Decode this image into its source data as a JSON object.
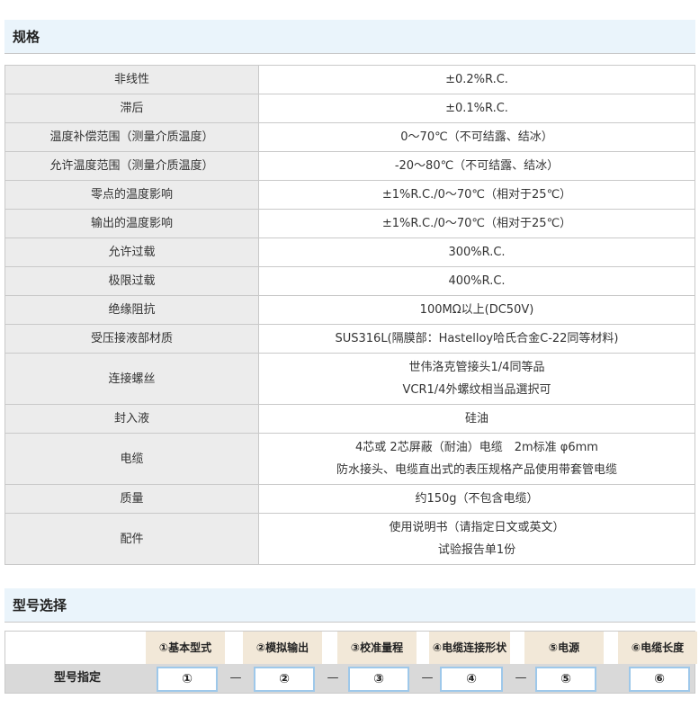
{
  "spec_section": {
    "title": "规格",
    "rows": [
      {
        "label": "非线性",
        "lines": [
          "±0.2%R.C."
        ]
      },
      {
        "label": "滞后",
        "lines": [
          "±0.1%R.C."
        ]
      },
      {
        "label": "温度补偿范围（测量介质温度）",
        "lines": [
          "0～70℃（不可结露、结冰）"
        ]
      },
      {
        "label": "允许温度范围（测量介质温度）",
        "lines": [
          "-20～80℃（不可结露、结冰）"
        ]
      },
      {
        "label": "零点的温度影响",
        "lines": [
          "±1%R.C./0～70℃（相对于25℃）"
        ]
      },
      {
        "label": "输出的温度影响",
        "lines": [
          "±1%R.C./0～70℃（相对于25℃）"
        ]
      },
      {
        "label": "允许过载",
        "lines": [
          "300%R.C."
        ]
      },
      {
        "label": "极限过载",
        "lines": [
          "400%R.C."
        ]
      },
      {
        "label": "绝缘阻抗",
        "lines": [
          "100MΩ以上(DC50V)"
        ]
      },
      {
        "label": "受压接液部材质",
        "lines": [
          "SUS316L(隔膜部：Hastelloy哈氏合金C-22同等材料)"
        ]
      },
      {
        "label": "连接螺丝",
        "lines": [
          "世伟洛克管接头1/4同等品",
          "VCR1/4外螺纹相当品選択可"
        ]
      },
      {
        "label": "封入液",
        "lines": [
          "硅油"
        ]
      },
      {
        "label": "电缆",
        "lines": [
          "4芯或 2芯屏蔽（耐油）电缆　2m标准 φ6mm",
          "防水接头、电缆直出式的表压规格产品使用带套管电缆"
        ]
      },
      {
        "label": "质量",
        "lines": [
          "约150g（不包含电缆）"
        ]
      },
      {
        "label": "配件",
        "lines": [
          "使用说明书（请指定日文或英文）",
          "试验报告单1份"
        ]
      }
    ]
  },
  "model_section": {
    "title": "型号选择",
    "row_title": "型号指定",
    "columns": [
      {
        "head": "①基本型式",
        "code": "①"
      },
      {
        "head": "②模拟输出",
        "code": "②"
      },
      {
        "head": "③校准量程",
        "code": "③"
      },
      {
        "head": "④电缆连接形状",
        "code": "④"
      },
      {
        "head": "⑤电源",
        "code": "⑤"
      },
      {
        "head": "⑥电缆长度",
        "code": "⑥"
      }
    ],
    "dash": "—"
  }
}
